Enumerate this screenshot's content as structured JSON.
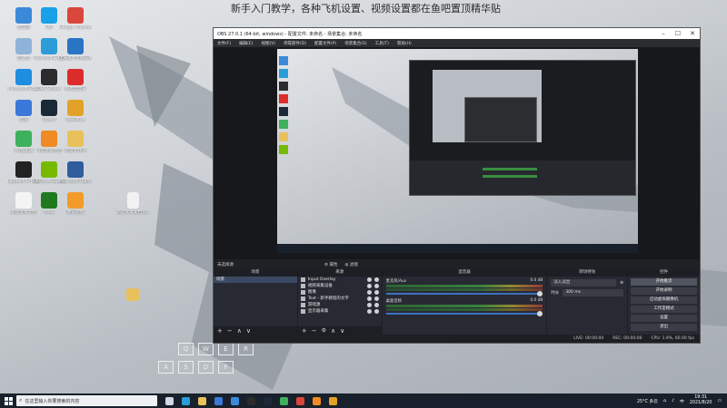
{
  "banner": "新手入门教学，各种飞机设置、视频设置都在鱼吧置顶精华贴",
  "desktop_icons": [
    {
      "label": "此电脑",
      "color": "#3b8ad9"
    },
    {
      "label": "QQ",
      "color": "#19a0e8"
    },
    {
      "label": "Google Chrome",
      "color": "#d9463b"
    },
    {
      "label": "回收站",
      "color": "#8fb3d8"
    },
    {
      "label": "Microsoft Edge",
      "color": "#2b9cd8"
    },
    {
      "label": "上海聚力传媒技术",
      "color": "#2a74c4"
    },
    {
      "label": "Microsoft Edge",
      "color": "#1f8de0"
    },
    {
      "label": "OBS Studio",
      "color": "#2c2c2c"
    },
    {
      "label": "网易云音乐",
      "color": "#dd2c2c"
    },
    {
      "label": "迅雷",
      "color": "#3b78d8"
    },
    {
      "label": "Steam",
      "color": "#1b2838"
    },
    {
      "label": "WeGame",
      "color": "#e2a227"
    },
    {
      "label": "UU加速器",
      "color": "#3fb05c"
    },
    {
      "label": "斗鱼直播伴侣",
      "color": "#f08a24"
    },
    {
      "label": "新建文件夹",
      "color": "#e8c15a"
    },
    {
      "label": "Logitech G HUB",
      "color": "#222"
    },
    {
      "label": "GeForce Experience",
      "color": "#76b900"
    },
    {
      "label": "Microsoft Flight Simulator",
      "color": "#2f5d9e"
    },
    {
      "label": "新建文本文档",
      "color": "#f4f4f4"
    },
    {
      "label": "Xbox",
      "color": "#1f7a1f"
    },
    {
      "label": "腾讯视频",
      "color": "#f29b28"
    }
  ],
  "desktop_file_label": "新建文本文档.txt",
  "obs": {
    "title": "OBS 27.0.1 (64-bit, windows) - 配置文件: 未命名 - 场景集合: 未命名",
    "menu": [
      "文件(F)",
      "编辑(E)",
      "视图(V)",
      "停靠部件(D)",
      "配置文件(P)",
      "场景集合(S)",
      "工具(T)",
      "帮助(H)"
    ],
    "no_source": "未选择源",
    "props_label": "属性",
    "filters_label": "滤镜",
    "docks": {
      "scenes": "场景",
      "sources": "来源",
      "mixer": "混音器",
      "transitions": "转场特效",
      "controls": "控件"
    },
    "scene_items": [
      "场景"
    ],
    "source_items": [
      "Input Overlay",
      "视频采集设备",
      "图像",
      "Text - 新手教程的文字",
      "游戏源",
      "显示器采集"
    ],
    "mixer": [
      {
        "name": "麦克风/Aux",
        "db": "0.0 dB"
      },
      {
        "name": "桌面音频",
        "db": "0.0 dB"
      }
    ],
    "transition": {
      "type": "淡入淡出",
      "duration_label": "时长",
      "duration": "300 ms"
    },
    "controls": [
      "开始推流",
      "开始录制",
      "启动虚拟摄像机",
      "工作室模式",
      "设置",
      "退出"
    ],
    "status": {
      "live": "LIVE: 00:00:00",
      "rec": "REC: 00:00:00",
      "cpu": "CPU: 1.9%, 60.00 fps"
    }
  },
  "keyboard": [
    "Q",
    "W",
    "E",
    "R",
    "A",
    "S",
    "D",
    "F"
  ],
  "taskbar": {
    "search_placeholder": "在这里输入你要搜索的内容",
    "weather": "25°C 多云",
    "time": "19:31",
    "date": "2021/8/20",
    "lang": "中",
    "apps": [
      {
        "name": "task-view",
        "color": "#cfd8e3"
      },
      {
        "name": "edge",
        "color": "#2b9cd8"
      },
      {
        "name": "file-explorer",
        "color": "#e8c15a"
      },
      {
        "name": "store",
        "color": "#3b78d8"
      },
      {
        "name": "mail",
        "color": "#3b8ad9"
      },
      {
        "name": "obs",
        "color": "#2c2c2c"
      },
      {
        "name": "steam",
        "color": "#1b2838"
      },
      {
        "name": "app",
        "color": "#3fb05c"
      },
      {
        "name": "app2",
        "color": "#d9463b"
      },
      {
        "name": "app3",
        "color": "#f08a24"
      },
      {
        "name": "app4",
        "color": "#e2a227"
      }
    ]
  }
}
